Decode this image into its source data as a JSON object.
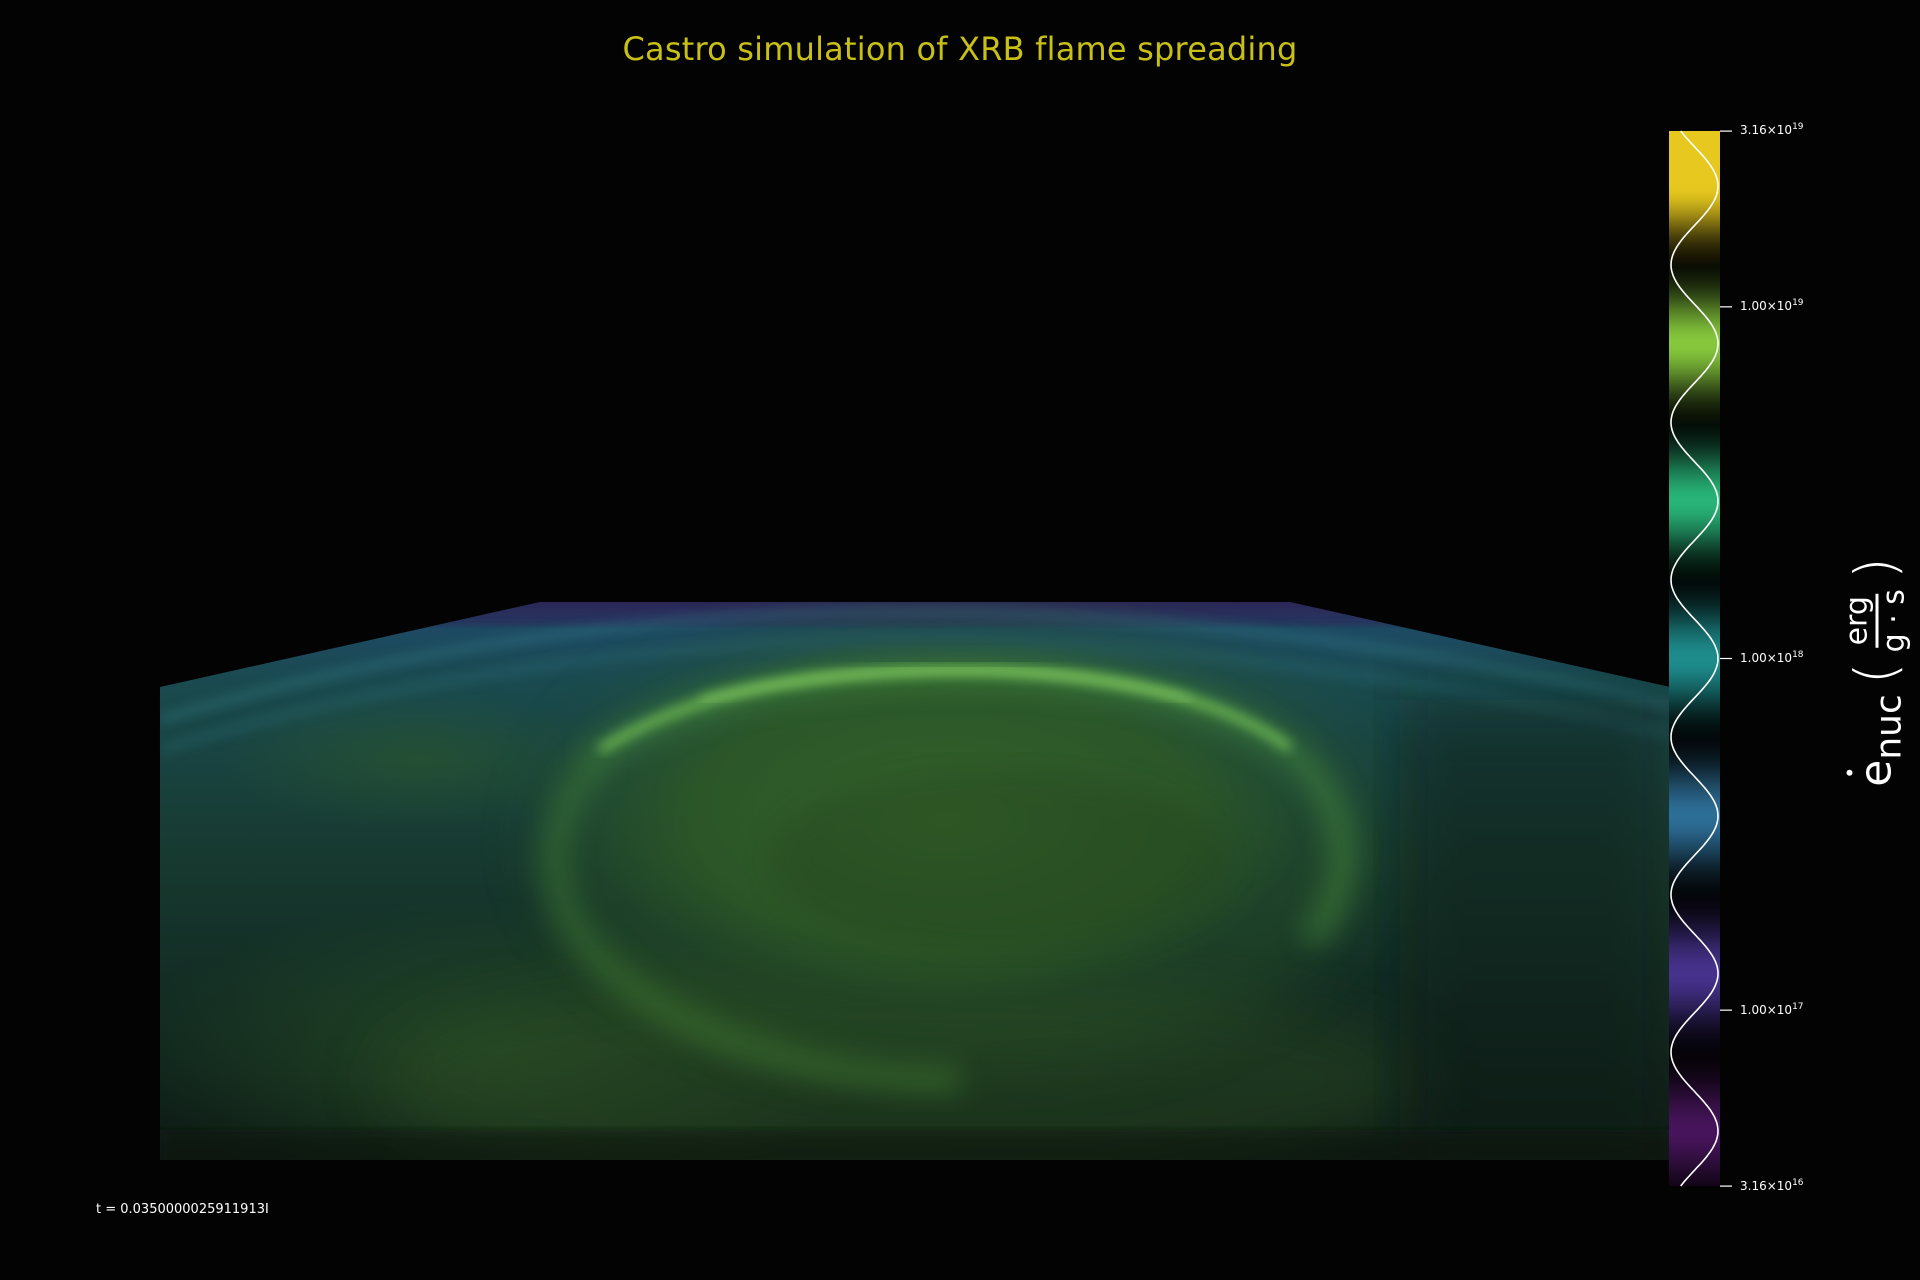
{
  "title": "Castro simulation of XRB flame spreading",
  "time_label": "t = 0.0350000025911913I",
  "colorbar": {
    "label_symbol": "e",
    "label_subscript": "nuc",
    "label_unit_numerator": "erg",
    "label_unit_denominator": "g · s",
    "scale": "log",
    "range": [
      "3.16 × 10^16",
      "3.16 × 10^19"
    ],
    "ticks": [
      {
        "mantissa": "3.16",
        "exponent": "19"
      },
      {
        "mantissa": "1.00",
        "exponent": "19"
      },
      {
        "mantissa": "1.00",
        "exponent": "18"
      },
      {
        "mantissa": "1.00",
        "exponent": "17"
      },
      {
        "mantissa": "3.16",
        "exponent": "16"
      }
    ],
    "band_colors": [
      "#e6c81e",
      "#86c83c",
      "#28b478",
      "#1e8c8c",
      "#2d6e96",
      "#46328c",
      "#46145a"
    ]
  }
}
